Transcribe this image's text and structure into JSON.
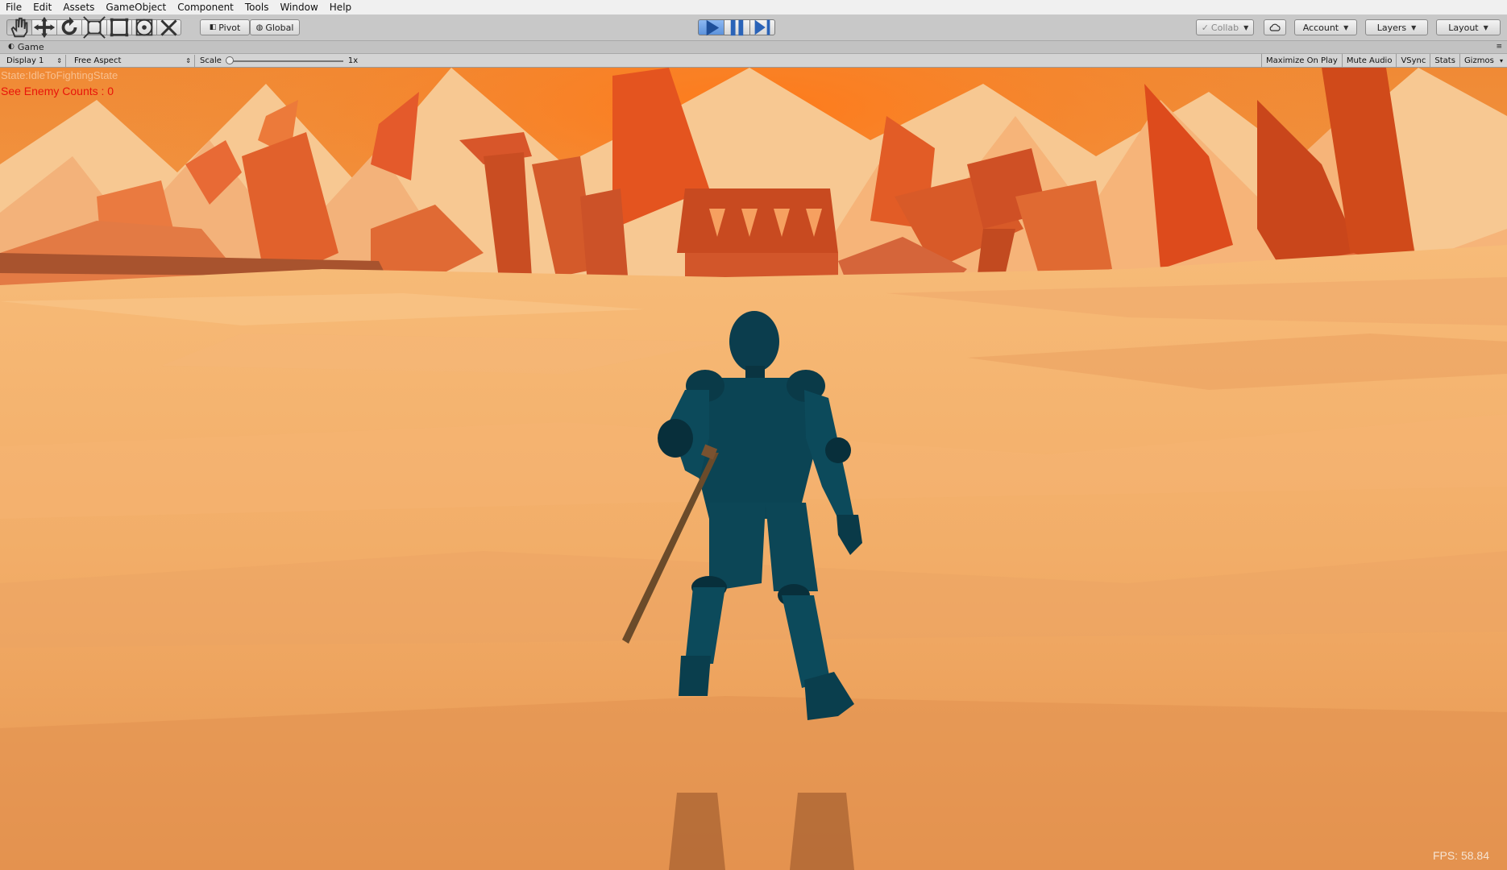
{
  "menu": [
    "File",
    "Edit",
    "Assets",
    "GameObject",
    "Component",
    "Tools",
    "Window",
    "Help"
  ],
  "toolbar": {
    "pivot_label": "Pivot",
    "global_label": "Global",
    "collab_label": "Collab",
    "account_label": "Account",
    "layers_label": "Layers",
    "layout_label": "Layout",
    "accent_play": "#5c92dc"
  },
  "game_tab": {
    "title": "Game"
  },
  "game_toolbar": {
    "display": "Display 1",
    "aspect": "Free Aspect",
    "scale_label": "Scale",
    "scale_value": "1x",
    "scale_level": 0.0,
    "maximize_on_play": "Maximize On Play",
    "mute_audio": "Mute Audio",
    "vsync": "VSync",
    "stats": "Stats",
    "gizmos": "Gizmos"
  },
  "game_view": {
    "state_text": "State:IdleToFightingState",
    "enemy_counts": "See Enemy Counts : 0",
    "fps": "FPS: 58.84"
  }
}
